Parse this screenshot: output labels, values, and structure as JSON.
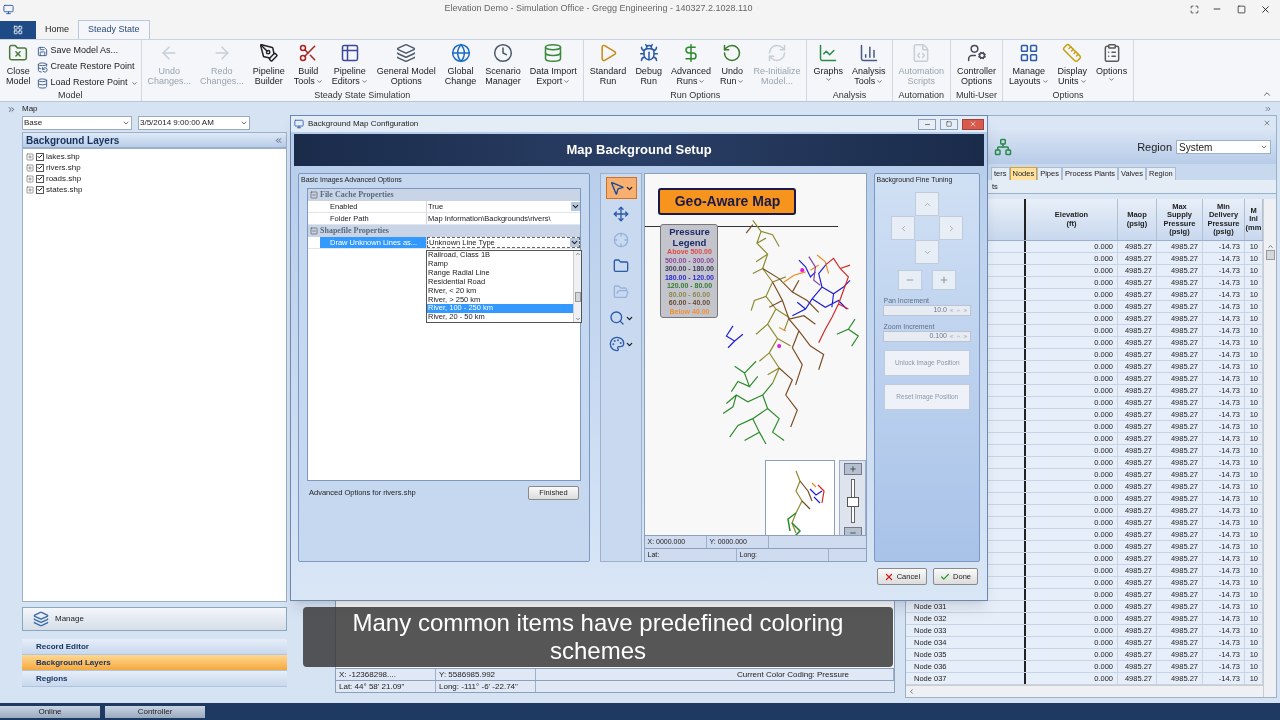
{
  "window": {
    "title": "Elevation Demo - Simulation Office - Gregg Engineering - 140327.2.1028.110"
  },
  "ribbon": {
    "tabs": [
      {
        "label": "Home",
        "selected": false
      },
      {
        "label": "Steady State",
        "selected": true
      }
    ],
    "groups": [
      {
        "label": "Model",
        "items": [
          {
            "kind": "large",
            "lines": [
              "Close",
              "Model"
            ],
            "disabled": false,
            "menu": false
          },
          {
            "kind": "small",
            "lines": [
              "Save Model As..."
            ],
            "disabled": false,
            "menu": false
          },
          {
            "kind": "small",
            "lines": [
              "Create Restore Point"
            ],
            "disabled": false,
            "menu": false
          },
          {
            "kind": "small",
            "lines": [
              "Load Restore Point"
            ],
            "disabled": false,
            "menu": true
          }
        ]
      },
      {
        "label": "Steady State Simulation",
        "items": [
          {
            "kind": "large",
            "lines": [
              "Undo",
              "Changes..."
            ],
            "disabled": true,
            "menu": false
          },
          {
            "kind": "large",
            "lines": [
              "Redo",
              "Changes..."
            ],
            "disabled": true,
            "menu": false
          },
          {
            "kind": "large",
            "lines": [
              "Pipeline",
              "Builder"
            ],
            "disabled": false,
            "menu": false
          },
          {
            "kind": "large",
            "lines": [
              "Build",
              "Tools"
            ],
            "disabled": false,
            "menu": true
          },
          {
            "kind": "large",
            "lines": [
              "Pipeline",
              "Editors"
            ],
            "disabled": false,
            "menu": true
          },
          {
            "kind": "large",
            "lines": [
              "General Model",
              "Options"
            ],
            "disabled": false,
            "menu": false
          },
          {
            "kind": "large",
            "lines": [
              "Global",
              "Change"
            ],
            "disabled": false,
            "menu": false
          },
          {
            "kind": "large",
            "lines": [
              "Scenario",
              "Manager"
            ],
            "disabled": false,
            "menu": false
          },
          {
            "kind": "large",
            "lines": [
              "Data Import",
              "Export"
            ],
            "disabled": false,
            "menu": true
          }
        ]
      },
      {
        "label": "Run Options",
        "items": [
          {
            "kind": "large",
            "lines": [
              "Standard",
              "Run"
            ],
            "disabled": false,
            "menu": false
          },
          {
            "kind": "large",
            "lines": [
              "Debug",
              "Run"
            ],
            "disabled": false,
            "menu": false
          },
          {
            "kind": "large",
            "lines": [
              "Advanced",
              "Runs"
            ],
            "disabled": false,
            "menu": true
          },
          {
            "kind": "large",
            "lines": [
              "Undo",
              "Run"
            ],
            "disabled": false,
            "menu": true
          },
          {
            "kind": "large",
            "lines": [
              "Re-Initialize",
              "Model..."
            ],
            "disabled": true,
            "menu": false
          }
        ]
      },
      {
        "label": "Analysis",
        "items": [
          {
            "kind": "large",
            "lines": [
              "Graphs"
            ],
            "disabled": false,
            "menu": true
          },
          {
            "kind": "large",
            "lines": [
              "Analysis",
              "Tools"
            ],
            "disabled": false,
            "menu": true
          }
        ]
      },
      {
        "label": "Automation",
        "items": [
          {
            "kind": "large",
            "lines": [
              "Automation",
              "Scripts"
            ],
            "disabled": true,
            "menu": false
          }
        ]
      },
      {
        "label": "Multi-User",
        "items": [
          {
            "kind": "large",
            "lines": [
              "Controller",
              "Options"
            ],
            "disabled": false,
            "menu": false
          }
        ]
      },
      {
        "label": "Options",
        "items": [
          {
            "kind": "large",
            "lines": [
              "Manage",
              "Layouts"
            ],
            "disabled": false,
            "menu": true
          },
          {
            "kind": "large",
            "lines": [
              "Display",
              "Units"
            ],
            "disabled": false,
            "menu": true
          },
          {
            "kind": "large",
            "lines": [
              "Options"
            ],
            "disabled": false,
            "menu": true
          }
        ]
      }
    ]
  },
  "left_panel": {
    "header": "Map",
    "base_select": "Base",
    "date_field": "3/5/2014 9:00:00 AM",
    "section_title": "Background Layers",
    "layers": [
      {
        "label": "lakes.shp",
        "checked": true
      },
      {
        "label": "rivers.shp",
        "checked": true
      },
      {
        "label": "roads.shp",
        "checked": true
      },
      {
        "label": "states.shp",
        "checked": true
      }
    ],
    "manage_button": "Manage",
    "nav": [
      {
        "label": "Record Editor",
        "selected": false
      },
      {
        "label": "Background Layers",
        "selected": true
      },
      {
        "label": "Regions",
        "selected": false
      }
    ]
  },
  "map_view": {
    "status_rows": [
      [
        "X: -12368298....",
        "Y: 5586985.992",
        "Current Color Coding: Pressure"
      ],
      [
        "Lat: 44° 58' 21.09\"",
        "Long: -111° -6' -22.74\""
      ]
    ]
  },
  "dialog": {
    "title": "Background Map Configuration",
    "banner": "Map Background Setup",
    "options_label": "Basic Images Advanced Options",
    "property_grid": [
      {
        "label": "File Cache Properties",
        "expanded": true,
        "rows": [
          {
            "label": "Enabled",
            "value": "True",
            "kind": "dropdown",
            "selected": false
          },
          {
            "label": "Folder Path",
            "value": "Map Information\\Backgrounds\\rivers\\",
            "kind": "text",
            "selected": false
          }
        ]
      },
      {
        "label": "Shapefile Properties",
        "expanded": true,
        "rows": [
          {
            "label": "Draw Unknown Lines as...",
            "value": "Unknown Line Type",
            "kind": "dropdown",
            "selected": true
          }
        ]
      }
    ],
    "dropdown_list": [
      {
        "label": "Railroad, Class 1B",
        "selected": false
      },
      {
        "label": "Ramp",
        "selected": false
      },
      {
        "label": "Range Radial Line",
        "selected": false
      },
      {
        "label": "Residential Road",
        "selected": false
      },
      {
        "label": "River, < 20 km",
        "selected": false
      },
      {
        "label": "River, > 250 km",
        "selected": false
      },
      {
        "label": "River, 100 - 250 km",
        "selected": true
      },
      {
        "label": "River, 20 - 50 km",
        "selected": false
      }
    ],
    "footer_note": "Advanced Options for rivers.shp",
    "finished_button": "Finished",
    "tools": [
      {
        "selected": true,
        "disabled": false,
        "menu": true
      },
      {
        "selected": false,
        "disabled": false,
        "menu": false
      },
      {
        "selected": false,
        "disabled": true,
        "menu": false
      },
      {
        "selected": false,
        "disabled": false,
        "menu": false
      },
      {
        "selected": false,
        "disabled": true,
        "menu": false
      },
      {
        "selected": false,
        "disabled": false,
        "menu": true
      },
      {
        "selected": false,
        "disabled": false,
        "menu": true
      }
    ],
    "map": {
      "badge": "Geo-Aware Map",
      "legend": {
        "title": "Pressure Legend",
        "entries": [
          {
            "label": "Above 500.00",
            "color": "#e04848"
          },
          {
            "label": "500.00 - 300.00",
            "color": "#8a4a9a"
          },
          {
            "label": "300.00 - 180.00",
            "color": "#404060"
          },
          {
            "label": "180.00 - 120.00",
            "color": "#2a2ad8"
          },
          {
            "label": "120.00 - 80.00",
            "color": "#2e7e2e"
          },
          {
            "label": "80.00 - 60.00",
            "color": "#8c8a48"
          },
          {
            "label": "60.00 - 40.00",
            "color": "#6a4a30"
          },
          {
            "label": "Below 40.00",
            "color": "#f09030"
          }
        ]
      },
      "zoom_slider": {
        "level": 0.5
      },
      "coords": [
        [
          "X: 0000.000",
          "Y: 0000.000"
        ],
        [
          "Lat:",
          "Long:"
        ]
      ]
    },
    "fine_tuning": {
      "title": "Background Fine Tuning",
      "pan_label": "Pan Increment",
      "pan_value": "10.0",
      "zoom_label": "Zoom Increment",
      "zoom_value": "0.100",
      "buttons": [
        "Unlock Image Position",
        "Reset Image Position"
      ],
      "disabled": true
    },
    "buttons": [
      {
        "label": "Cancel",
        "kind": "cancel"
      },
      {
        "label": "Done",
        "kind": "done"
      }
    ]
  },
  "grid_panel": {
    "region_label": "Region",
    "region_value": "System",
    "tabs": [
      {
        "label": "ters",
        "selected": false
      },
      {
        "label": "Nodes",
        "selected": true
      },
      {
        "label": "Pipes",
        "selected": false
      },
      {
        "label": "Process Plants",
        "selected": false
      },
      {
        "label": "Valves",
        "selected": false
      },
      {
        "label": "Region",
        "selected": false
      }
    ],
    "subbar": "ts",
    "columns": [
      {
        "lines": [
          "Elevation",
          "(ft)"
        ]
      },
      {
        "lines": [
          "Maop",
          "(psig)"
        ]
      },
      {
        "lines": [
          "Max",
          "Supply",
          "Pressure",
          "(psig)"
        ]
      },
      {
        "lines": [
          "Min",
          "Delivery",
          "Pressure",
          "(psig)"
        ]
      },
      {
        "lines": [
          "M",
          "Inl",
          "(mm"
        ]
      }
    ],
    "rows": [
      {
        "cells": [
          "0.000",
          "4985.27",
          "4985.27",
          "-14.73",
          "10"
        ]
      },
      {
        "cells": [
          "0.000",
          "4985.27",
          "4985.27",
          "-14.73",
          "10"
        ]
      },
      {
        "cells": [
          "0.000",
          "4985.27",
          "4985.27",
          "-14.73",
          "10"
        ]
      },
      {
        "cells": [
          "0.000",
          "4985.27",
          "4985.27",
          "-14.73",
          "10"
        ]
      },
      {
        "cells": [
          "0.000",
          "4985.27",
          "4985.27",
          "-14.73",
          "10"
        ]
      },
      {
        "cells": [
          "0.000",
          "4985.27",
          "4985.27",
          "-14.73",
          "10"
        ]
      },
      {
        "cells": [
          "0.000",
          "4985.27",
          "4985.27",
          "-14.73",
          "10"
        ]
      },
      {
        "cells": [
          "0.000",
          "4985.27",
          "4985.27",
          "-14.73",
          "10"
        ]
      },
      {
        "cells": [
          "0.000",
          "4985.27",
          "4985.27",
          "-14.73",
          "10"
        ]
      },
      {
        "cells": [
          "0.000",
          "4985.27",
          "4985.27",
          "-14.73",
          "10"
        ]
      },
      {
        "cells": [
          "0.000",
          "4985.27",
          "4985.27",
          "-14.73",
          "10"
        ]
      },
      {
        "cells": [
          "0.000",
          "4985.27",
          "4985.27",
          "-14.73",
          "10"
        ]
      },
      {
        "cells": [
          "0.000",
          "4985.27",
          "4985.27",
          "-14.73",
          "10"
        ]
      },
      {
        "cells": [
          "0.000",
          "4985.27",
          "4985.27",
          "-14.73",
          "10"
        ]
      },
      {
        "cells": [
          "0.000",
          "4985.27",
          "4985.27",
          "-14.73",
          "10"
        ]
      },
      {
        "cells": [
          "0.000",
          "4985.27",
          "4985.27",
          "-14.73",
          "10"
        ]
      },
      {
        "cells": [
          "0.000",
          "4985.27",
          "4985.27",
          "-14.73",
          "10"
        ]
      },
      {
        "cells": [
          "0.000",
          "4985.27",
          "4985.27",
          "-14.73",
          "10"
        ]
      },
      {
        "cells": [
          "0.000",
          "4985.27",
          "4985.27",
          "-14.73",
          "10"
        ]
      },
      {
        "cells": [
          "0.000",
          "4985.27",
          "4985.27",
          "-14.73",
          "10"
        ]
      },
      {
        "cells": [
          "0.000",
          "4985.27",
          "4985.27",
          "-14.73",
          "10"
        ]
      },
      {
        "cells": [
          "0.000",
          "4985.27",
          "4985.27",
          "-14.73",
          "10"
        ]
      },
      {
        "cells": [
          "0.000",
          "4985.27",
          "4985.27",
          "-14.73",
          "10"
        ]
      },
      {
        "cells": [
          "0.000",
          "4985.27",
          "4985.27",
          "-14.73",
          "10"
        ]
      },
      {
        "cells": [
          "0.000",
          "4985.27",
          "4985.27",
          "-14.73",
          "10"
        ]
      },
      {
        "cells": [
          "0.000",
          "4985.27",
          "4985.27",
          "-14.73",
          "10"
        ]
      },
      {
        "cells": [
          "0.000",
          "4985.27",
          "4985.27",
          "-14.73",
          "10"
        ]
      },
      {
        "cells": [
          "0.000",
          "4985.27",
          "4985.27",
          "-14.73",
          "10"
        ]
      },
      {
        "cells": [
          "0.000",
          "4985.27",
          "4985.27",
          "-14.73",
          "10"
        ]
      },
      {
        "cells": [
          "0.000",
          "4985.27",
          "4985.27",
          "-14.73",
          "10"
        ]
      },
      {
        "name": "Node 031",
        "cells": [
          "0.000",
          "4985.27",
          "4985.27",
          "-14.73",
          "10"
        ]
      },
      {
        "name": "Node 032",
        "cells": [
          "0.000",
          "4985.27",
          "4985.27",
          "-14.73",
          "10"
        ]
      },
      {
        "name": "Node 033",
        "cells": [
          "0.000",
          "4985.27",
          "4985.27",
          "-14.73",
          "10"
        ]
      },
      {
        "name": "Node 034",
        "cells": [
          "0.000",
          "4985.27",
          "4985.27",
          "-14.73",
          "10"
        ]
      },
      {
        "name": "Node 035",
        "cells": [
          "0.000",
          "4985.27",
          "4985.27",
          "-14.73",
          "10"
        ]
      },
      {
        "name": "Node 036",
        "cells": [
          "0.000",
          "4985.27",
          "4985.27",
          "-14.73",
          "10"
        ]
      },
      {
        "name": "Node 037",
        "cells": [
          "0.000",
          "4985.27",
          "4985.27",
          "-14.73",
          "10"
        ]
      }
    ]
  },
  "caption": "Many common items have predefined coloring schemes",
  "status_bar": {
    "tabs": [
      "Online",
      "Controller"
    ]
  }
}
